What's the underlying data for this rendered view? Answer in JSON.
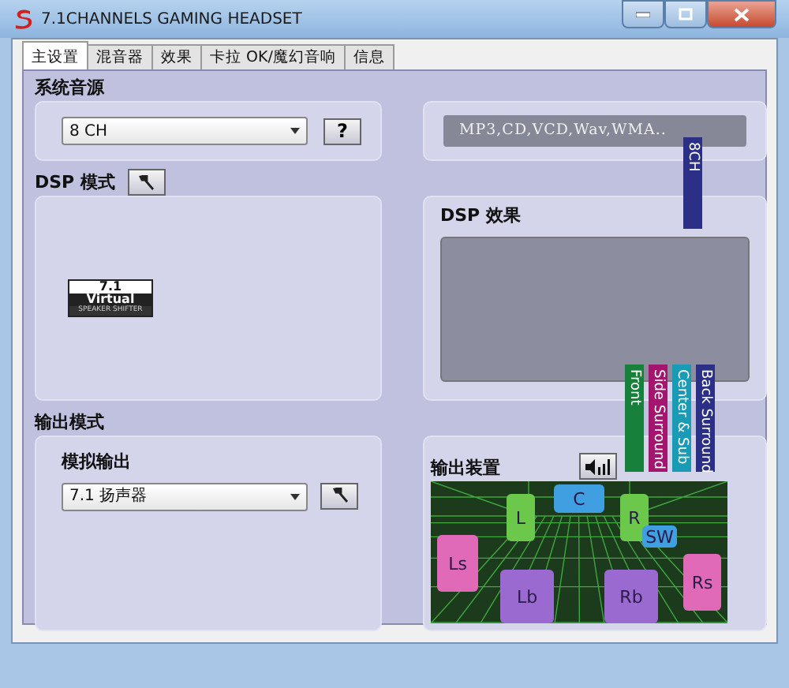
{
  "window": {
    "title": "7.1CHANNELS GAMING HEADSET"
  },
  "tabs": [
    {
      "label": "主设置",
      "selected": true
    },
    {
      "label": "混音器",
      "selected": false
    },
    {
      "label": "效果",
      "selected": false
    },
    {
      "label": "卡拉 OK/魔幻音响",
      "selected": false
    },
    {
      "label": "信息",
      "selected": false
    }
  ],
  "source": {
    "heading": "系统音源",
    "select_value": "8 CH",
    "help_button": "?",
    "formats": "MP3,CD,VCD,Wav,WMA..",
    "channel_strip": "8CH"
  },
  "dsp_mode": {
    "heading": "DSP 模式",
    "badge_lines": [
      "7.1",
      "Virtual",
      "SPEAKER SHIFTER"
    ]
  },
  "dsp_effect": {
    "heading": "DSP 效果"
  },
  "output_mode": {
    "heading": "输出模式",
    "label": "模拟输出",
    "select_value": "7.1 扬声器"
  },
  "output_device": {
    "heading": "输出装置",
    "channels": [
      {
        "label": "Front",
        "color": "#17803a"
      },
      {
        "label": "Side Surround",
        "color": "#a3156f"
      },
      {
        "label": "Center & Sub",
        "color": "#1a9bb5"
      },
      {
        "label": "Back Surround",
        "color": "#2b2f86"
      }
    ],
    "speakers": [
      {
        "label": "L",
        "color": "#6cc84a"
      },
      {
        "label": "C",
        "color": "#3f9fe0"
      },
      {
        "label": "R",
        "color": "#6cc84a"
      },
      {
        "label": "SW",
        "color": "#3f9fe0"
      },
      {
        "label": "Ls",
        "color": "#e06ab8"
      },
      {
        "label": "Rs",
        "color": "#e06ab8"
      },
      {
        "label": "Lb",
        "color": "#9a6ad0"
      },
      {
        "label": "Rb",
        "color": "#9a6ad0"
      }
    ]
  }
}
